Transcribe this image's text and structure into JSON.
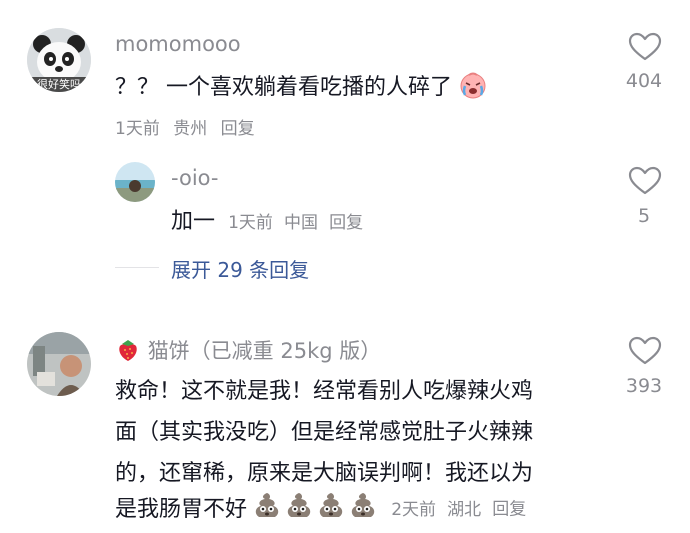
{
  "comments": [
    {
      "username": "momomooo",
      "avatar_text": "很好笑吗",
      "text": "？？ 一个喜欢躺着看吃播的人碎了",
      "emoji": "crying-face-icon",
      "time": "1天前",
      "location": "贵州",
      "reply_label": "回复",
      "likes": "404",
      "replies": [
        {
          "username": "-oio-",
          "text": "加一",
          "time": "1天前",
          "location": "中国",
          "reply_label": "回复",
          "likes": "5"
        }
      ],
      "expand_label": "展开 29 条回复"
    },
    {
      "username": "猫饼（已减重 25kg 版）",
      "text_lines": [
        "救命！这不就是我！经常看别人吃爆辣火鸡",
        "面（其实我没吃）但是经常感觉肚子火辣辣",
        "的，还窜稀，原来是大脑误判啊！我还以为",
        "是我肠胃不好"
      ],
      "time": "2天前",
      "location": "湖北",
      "reply_label": "回复",
      "likes": "393"
    }
  ],
  "colors": {
    "text": "#161823",
    "meta": "#8a8b91",
    "link": "#3b5998",
    "background": "#ffffff"
  }
}
